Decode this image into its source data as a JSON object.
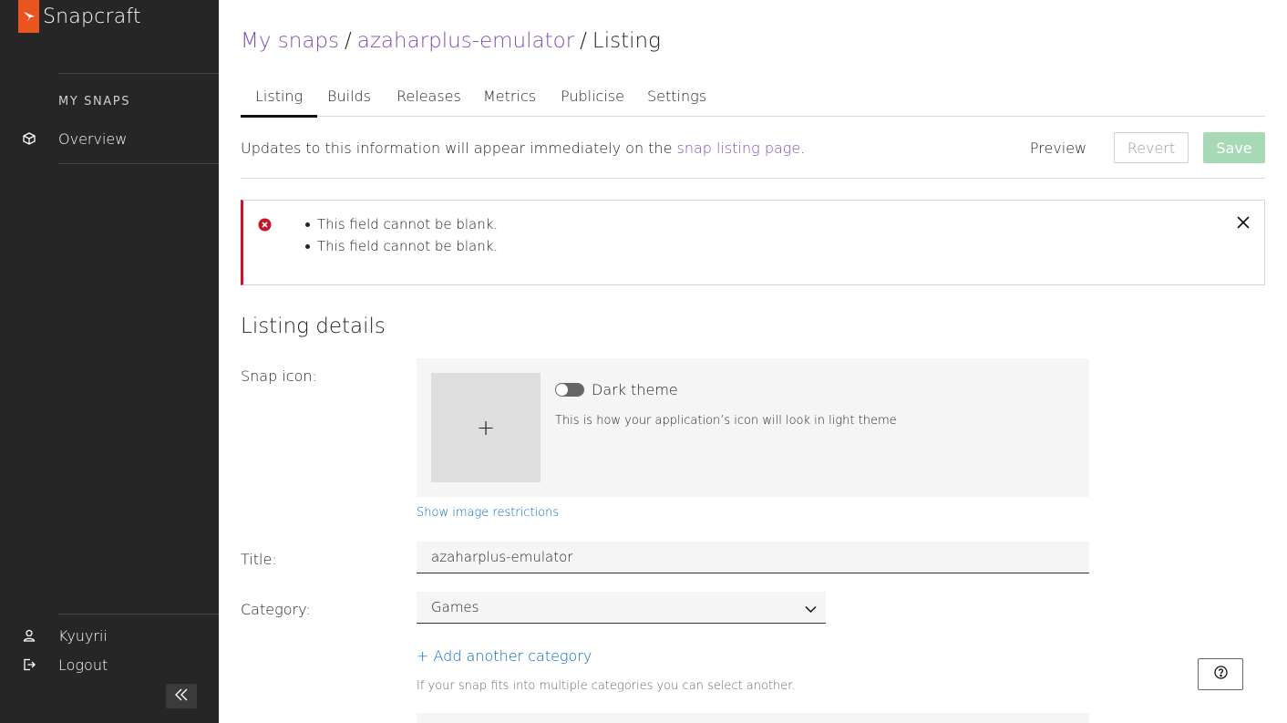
{
  "app": {
    "name": "Snapcraft"
  },
  "sidebar": {
    "heading": "MY SNAPS",
    "items": [
      {
        "label": "Overview",
        "icon": "snap-package-icon"
      }
    ],
    "footer_items": [
      {
        "label": "Kyuyrii",
        "icon": "user-icon"
      },
      {
        "label": "Logout",
        "icon": "logout-icon"
      }
    ],
    "collapse_icon": "double-chevron-left-icon"
  },
  "breadcrumb": {
    "root": "My snaps",
    "snap": "azaharplus-emulator",
    "separator": "/",
    "current": "Listing"
  },
  "tabs": [
    {
      "label": "Listing",
      "active": true
    },
    {
      "label": "Builds",
      "active": false
    },
    {
      "label": "Releases",
      "active": false
    },
    {
      "label": "Metrics",
      "active": false
    },
    {
      "label": "Publicise",
      "active": false
    },
    {
      "label": "Settings",
      "active": false
    }
  ],
  "notice": {
    "text_before": "Updates to this information will appear immediately on the ",
    "link": "snap listing page",
    "text_after": "."
  },
  "actions": {
    "preview": "Preview",
    "revert": "Revert",
    "save": "Save"
  },
  "errors": [
    "This field cannot be blank.",
    "This field cannot be blank."
  ],
  "listing": {
    "section_title": "Listing details",
    "icon_label": "Snap icon:",
    "dark_theme_label": "Dark theme",
    "dark_theme_on": false,
    "theme_note": "This is how your application’s icon will look in light theme",
    "add_icon_glyph": "+",
    "restrictions_link": "Show image restrictions",
    "title_label": "Title:",
    "title_value": "azaharplus-emulator",
    "category_label": "Category:",
    "category_value": "Games",
    "add_category": "+ Add another category",
    "category_help": "If your snap fits into multiple categories you can select another."
  },
  "colors": {
    "sidebar_bg": "#262626",
    "brand_orange": "#e95420",
    "link_purple": "#7e4fb3",
    "link_blue": "#0066cc",
    "error_red": "#c7162b",
    "save_disabled": "#a8d9b5"
  }
}
